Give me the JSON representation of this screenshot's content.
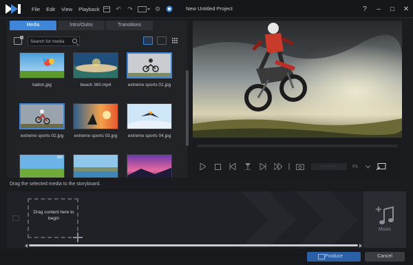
{
  "window": {
    "title": "New Untitled Project",
    "controls": {
      "help": "?",
      "minimize": "–",
      "maximize": "□",
      "close": "✕"
    }
  },
  "menu": [
    "File",
    "Edit",
    "View",
    "Playback"
  ],
  "toolbar_icons": [
    "layout-icon",
    "undo-icon",
    "redo-icon",
    "aspect-icon",
    "settings-icon",
    "update-icon"
  ],
  "library": {
    "tabs": [
      {
        "label": "Media",
        "active": true
      },
      {
        "label": "Intro/Outro",
        "active": false
      },
      {
        "label": "Transitions",
        "active": false
      }
    ],
    "search": {
      "placeholder": "Search for media"
    },
    "items": [
      {
        "name": "ballon.jpg",
        "selected": false,
        "badge": ""
      },
      {
        "name": "beach 360.mp4",
        "selected": false,
        "badge": ""
      },
      {
        "name": "extreme sports 01.jpg",
        "selected": true,
        "badge": ""
      },
      {
        "name": "extreme sports 02.jpg",
        "selected": true,
        "badge": ""
      },
      {
        "name": "extreme sports 03.jpg",
        "selected": false,
        "badge": ""
      },
      {
        "name": "extreme sports 04.jpg",
        "selected": false,
        "badge": ""
      },
      {
        "name": "",
        "selected": false,
        "badge": "360"
      },
      {
        "name": "",
        "selected": false,
        "badge": ""
      },
      {
        "name": "",
        "selected": false,
        "badge": ""
      }
    ]
  },
  "preview": {
    "progress": 0,
    "timecode": "--:--:--:--",
    "fit_label": "Fit"
  },
  "storyboard": {
    "hint": "Drag the selected media to the storyboard.",
    "drop_text_line1": "Drag content here to",
    "drop_text_line2": "begin",
    "music_label": "Music"
  },
  "buttons": {
    "produce": "Produce",
    "cancel": "Cancel"
  },
  "colors": {
    "accent": "#3d86d8",
    "background": "#1b1c20",
    "produce_button": "#2b5fa6"
  }
}
